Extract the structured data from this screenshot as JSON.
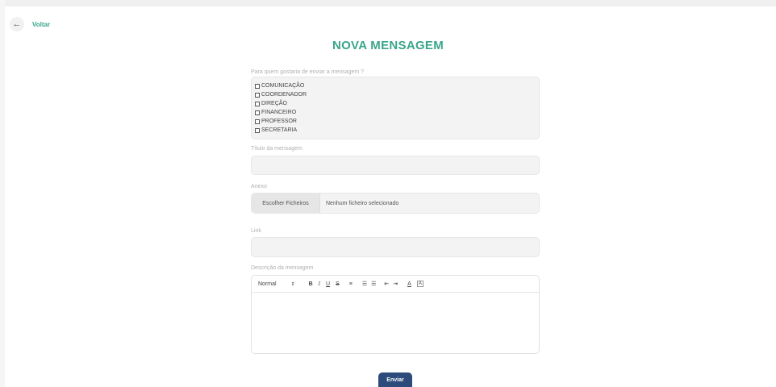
{
  "back": {
    "label": "Voltar"
  },
  "page_title": "NOVA MENSAGEM",
  "recipients": {
    "label": "Para quem gostaria de enviar a mensagem ?",
    "options": [
      "COMUNICAÇÃO",
      "COORDENADOR",
      "DIREÇÃO",
      "FINANCEIRO",
      "PROFESSOR",
      "SECRETARIA"
    ]
  },
  "message_title": {
    "label": "Título da mensagem",
    "value": ""
  },
  "attachment": {
    "label": "Anexo",
    "button_label": "Escolher Ficheiros",
    "status": "Nenhum ficheiro selecionado"
  },
  "link": {
    "label": "Link",
    "value": ""
  },
  "description": {
    "label": "Descrição da mensagem",
    "format_select": "Normal"
  },
  "send_button": "Enviar",
  "colors": {
    "accent": "#3aa58a",
    "button": "#2c4a7a"
  }
}
